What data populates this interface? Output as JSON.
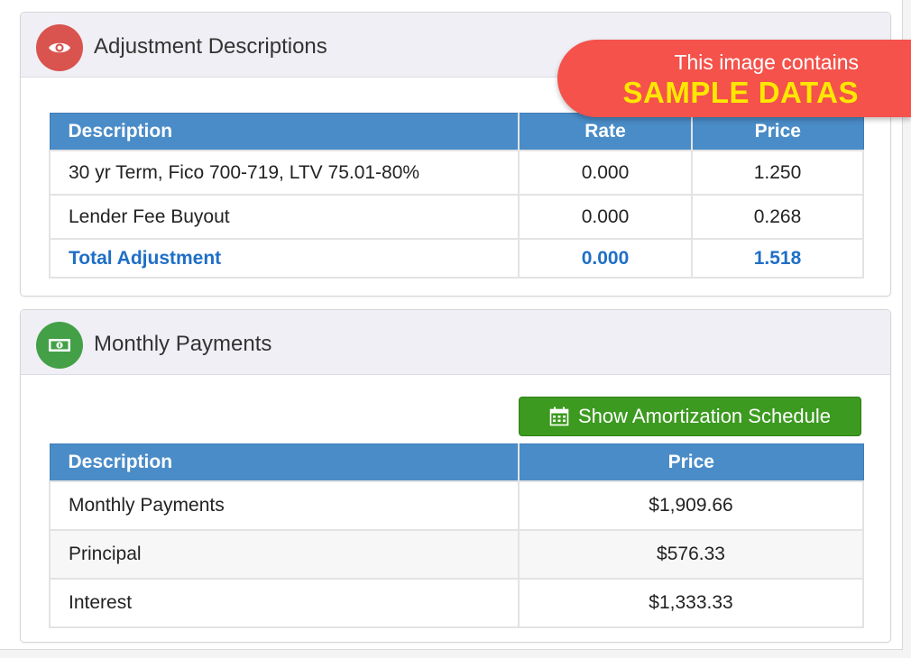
{
  "adjustment": {
    "title": "Adjustment Descriptions",
    "icon": "eye-icon",
    "icon_color": "#d9534f",
    "columns": [
      "Description",
      "Rate",
      "Price"
    ],
    "rows": [
      {
        "description": "30 yr Term, Fico 700-719, LTV 75.01-80%",
        "rate": "0.000",
        "price": "1.250"
      },
      {
        "description": "Lender Fee Buyout",
        "rate": "0.000",
        "price": "0.268"
      }
    ],
    "total": {
      "label": "Total Adjustment",
      "rate": "0.000",
      "price": "1.518"
    }
  },
  "payments": {
    "title": "Monthly Payments",
    "icon": "money-icon",
    "icon_color": "#43a047",
    "amortization_button": "Show Amortization Schedule",
    "button_icon": "calendar-icon",
    "columns": [
      "Description",
      "Price"
    ],
    "rows": [
      {
        "description": "Monthly Payments",
        "price": "$1,909.66"
      },
      {
        "description": "Principal",
        "price": "$576.33"
      },
      {
        "description": "Interest",
        "price": "$1,333.33"
      }
    ]
  },
  "sample_badge": {
    "line1": "This image contains",
    "line2": "SAMPLE DATAS"
  },
  "colors": {
    "header_blue": "#4a8cc8",
    "total_blue": "#1f6fc7",
    "button_green": "#3c9a20",
    "badge_red": "#f4524b",
    "badge_yellow": "#ffe800"
  }
}
